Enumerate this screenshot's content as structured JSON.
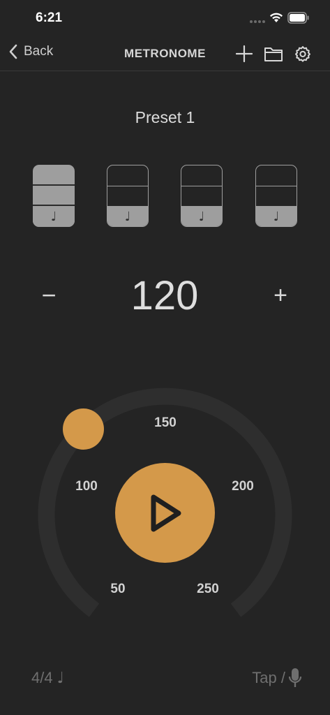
{
  "status_bar": {
    "time": "6:21"
  },
  "nav": {
    "back_label": "Back",
    "title": "METRONOME",
    "icons": [
      "plus-icon",
      "folder-icon",
      "gear-icon"
    ]
  },
  "preset": {
    "name": "Preset 1"
  },
  "beats": [
    {
      "state": "accent",
      "note": "♩"
    },
    {
      "state": "normal",
      "note": "♩"
    },
    {
      "state": "normal",
      "note": "♩"
    },
    {
      "state": "normal",
      "note": "♩"
    }
  ],
  "tempo": {
    "minus_label": "−",
    "value": "120",
    "plus_label": "+"
  },
  "dial": {
    "labels": [
      "50",
      "100",
      "150",
      "200",
      "250"
    ],
    "play_icon": "play-icon"
  },
  "footer": {
    "time_signature": "4/4",
    "time_signature_note": "♩",
    "tap_label": "Tap /",
    "tap_icon": "microphone-icon"
  },
  "colors": {
    "background": "#242424",
    "accent": "#d4994a",
    "beat_fill": "#9e9e9e"
  }
}
